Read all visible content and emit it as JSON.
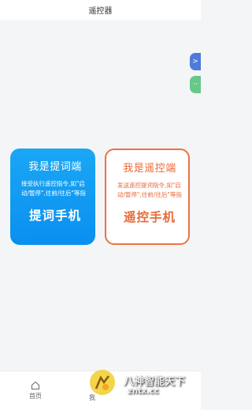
{
  "header": {
    "title": "遥控器"
  },
  "float_buttons": {
    "blue_label": ">",
    "green_label": "··"
  },
  "card_prompter": {
    "title": "我是提词端",
    "desc": "接受执行遥控指令,如\"启动/暂停\",往前/往后\"等指",
    "big_label": "提词手机"
  },
  "card_remote": {
    "title": "我是遥控端",
    "desc": "发送遥控提词指令,如\"启动/暂停\",往前/往后\"等指",
    "big_label": "遥控手机"
  },
  "tabbar": {
    "home_label": "首页",
    "second_label": "我"
  },
  "watermark": {
    "line1": "八神智能天下",
    "line2": "zntx.cc"
  },
  "colors": {
    "blue_card": "#0a8ff0",
    "orange_accent": "#ef7043"
  }
}
